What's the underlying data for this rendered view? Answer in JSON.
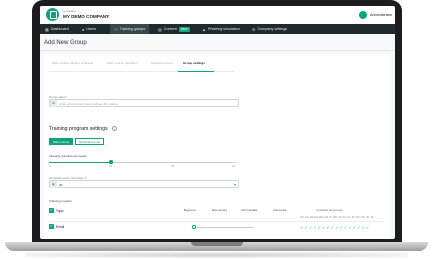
{
  "header": {
    "company_small_label": "Company",
    "company_name": "MY DEMO COMPANY",
    "user_label": "Administrator"
  },
  "nav": {
    "items": [
      {
        "label": "Dashboard",
        "icon": "grid-icon"
      },
      {
        "label": "Users",
        "icon": "user-icon"
      },
      {
        "label": "Training groups",
        "icon": "groups-icon"
      },
      {
        "label": "Content",
        "icon": "content-icon",
        "badge": "NEW"
      },
      {
        "label": "Phishing simulation",
        "icon": "phishing-icon"
      },
      {
        "label": "Company settings",
        "icon": "gear-icon"
      }
    ]
  },
  "page": {
    "title": "Add New Group"
  },
  "steps": [
    {
      "label": "Main course training schedule"
    },
    {
      "label": "Main course repetition"
    },
    {
      "label": "Optional course"
    },
    {
      "label": "Group settings"
    }
  ],
  "group_name": {
    "label": "Group name*",
    "placeholder": "Enter group name (users will see this name)"
  },
  "training_settings": {
    "title": "Training program settings",
    "mode_on": "Main course",
    "mode_off": "Optional course",
    "intensity_label": "Intensity (minutes per week)",
    "intensity_ticks": [
      "0",
      "10",
      "20",
      "30"
    ],
    "intensity_value": 10,
    "reminder_label": "Reminder every how days, h",
    "reminder_value": "30"
  },
  "program": {
    "label": "Training program",
    "levels": [
      "Beginner",
      "Elementary",
      "Intermediate",
      "Advanced"
    ],
    "languages_label": "Available languages",
    "language_codes": [
      "CS",
      "CA",
      "DA",
      "ES",
      "DE",
      "FR",
      "IT",
      "HR",
      "HU",
      "NL",
      "PL",
      "PT",
      "RO",
      "SK",
      "SL",
      "FI"
    ],
    "rows": [
      {
        "label": "Topic"
      },
      {
        "label": "Email"
      }
    ]
  },
  "colors": {
    "accent": "#0fa37f",
    "nav_bg": "#1f2a2c"
  }
}
